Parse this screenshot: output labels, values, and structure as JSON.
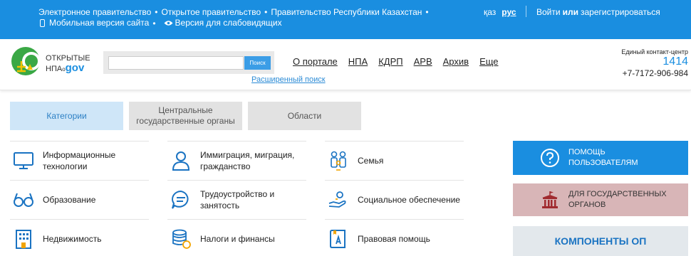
{
  "topbar": {
    "links": [
      "Электронное правительство",
      "Открытое правительство",
      "Правительство Республики Казахстан"
    ],
    "mobile_version": "Мобильная версия сайта",
    "low_vision_version": "Версия для слабовидящих",
    "lang_kz": "қаз",
    "lang_ru": "рус",
    "login": "Войти",
    "or": "или",
    "register": "зарегистрироваться"
  },
  "header": {
    "logo_line1": "ОТКРЫТЫЕ",
    "logo_line2": "НПА",
    "logo_gov": "gov",
    "search_placeholder": "",
    "search_button": "Поиск",
    "advanced_search": "Расширенный поиск",
    "nav": [
      "О портале",
      "НПА",
      "КДРП",
      "АРВ",
      "Архив",
      "Еще"
    ],
    "contact_label": "Единый контакт-центр",
    "contact_short": "1414",
    "contact_phone": "+7-7172-906-984"
  },
  "tabs": [
    "Категории",
    "Центральные государственные органы",
    "Области"
  ],
  "categories": [
    {
      "label": "Информационные технологии",
      "icon": "monitor-icon"
    },
    {
      "label": "Иммиграция, миграция, гражданство",
      "icon": "person-icon"
    },
    {
      "label": "Семья",
      "icon": "family-icon"
    },
    {
      "label": "Образование",
      "icon": "glasses-icon"
    },
    {
      "label": "Трудоустройство и занятость",
      "icon": "chat-icon"
    },
    {
      "label": "Социальное обеспечение",
      "icon": "hand-care-icon"
    },
    {
      "label": "Недвижимость",
      "icon": "building-icon"
    },
    {
      "label": "Налоги и финансы",
      "icon": "coins-icon"
    },
    {
      "label": "Правовая помощь",
      "icon": "law-book-icon"
    }
  ],
  "sidebar": {
    "help": "ПОМОЩЬ ПОЛЬЗОВАТЕЛЯМ",
    "gov": "ДЛЯ ГОСУДАРСТВЕННЫХ ОРГАНОВ",
    "components": "КОМПОНЕНТЫ ОП"
  },
  "colors": {
    "topbar": "#1a8ee0",
    "accent": "#1a8ee0",
    "tab_active": "#cfe6f8",
    "gov_block": "#d8b5b7"
  }
}
